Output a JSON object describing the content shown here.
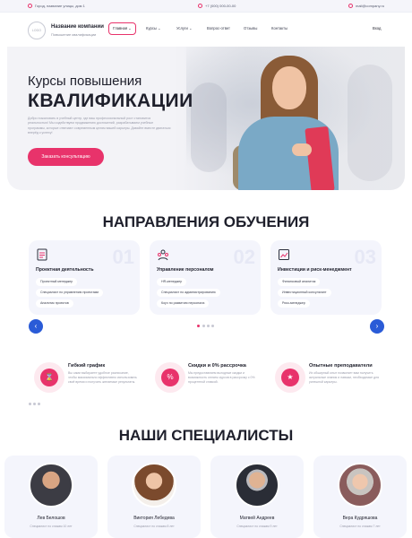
{
  "topbar": {
    "address": "Город, название улицы, дом 1",
    "phone": "+7 (000) 000-00-00",
    "email": "mail@company.ru"
  },
  "header": {
    "logo_text": "LOGO",
    "company_name": "Название компании",
    "slogan": "Повышение квалификации",
    "nav": [
      "Главная",
      "Курсы",
      "Услуги",
      "Вопрос-ответ",
      "Отзывы",
      "Контакты"
    ],
    "login": "Вход"
  },
  "hero": {
    "title_line1": "Курсы повышения",
    "title_line2": "КВАЛИФИКАЦИИ",
    "description": "Добро пожаловать в учебный центр, где ваш профессиональный рост становится реальностью! Мы содействуем продвижению достижений, разрабатываем учебные программы, которые отвечают современным целям вашей карьеры. Давайте вместе двигаться вперёд к успеху!",
    "cta": "Заказать консультацию"
  },
  "directions": {
    "heading": "НАПРАВЛЕНИЯ ОБУЧЕНИЯ",
    "cards": [
      {
        "number": "01",
        "title": "Проектная деятельность",
        "items": [
          "Проектный менеджер",
          "Специалист по управлению проектами",
          "Аналитик проектов"
        ]
      },
      {
        "number": "02",
        "title": "Управление персоналом",
        "items": [
          "HR-менеджер",
          "Специалист по администрированию",
          "Коуч по развитию персонала"
        ]
      },
      {
        "number": "03",
        "title": "Инвестиции и риск-менеджмент",
        "items": [
          "Финансовый аналитик",
          "Инвестиционный консультант",
          "Риск-менеджер"
        ]
      }
    ],
    "prev_icon": "chevron-left-icon",
    "next_icon": "chevron-right-icon"
  },
  "features": [
    {
      "icon": "hourglass-icon",
      "title": "Гибкий график",
      "description": "Вы сами выбираете удобное расписание, чтобы максимально эффективно использовать своё время и получить желаемые результаты."
    },
    {
      "icon": "percent-icon",
      "title": "Скидки и 0% рассрочка",
      "description": "Мы предоставляем выгодные скидки и возможность оплаты курсов в рассрочку с 0% процентной ставкой."
    },
    {
      "icon": "teacher-icon",
      "title": "Опытные преподаватели",
      "description": "Их обширный опыт позволяет вам получить актуальные знания и навыки, необходимые для успешной карьеры."
    }
  ],
  "specialists": {
    "heading": "НАШИ СПЕЦИАЛИСТЫ",
    "people": [
      {
        "name": "Лев Белошов",
        "role": "Специалист по стажам 10 лет"
      },
      {
        "name": "Виктория Лебедева",
        "role": "Специалист по стажам 8 лет"
      },
      {
        "name": "Матвей Андреев",
        "role": "Специалист по стажам 9 лет"
      },
      {
        "name": "Вера Кудряшова",
        "role": "Специалист по стажам 7 лет"
      }
    ]
  },
  "colors": {
    "accent": "#e8336b",
    "arrow": "#2a5bd7",
    "card_bg": "#f4f5fc"
  }
}
